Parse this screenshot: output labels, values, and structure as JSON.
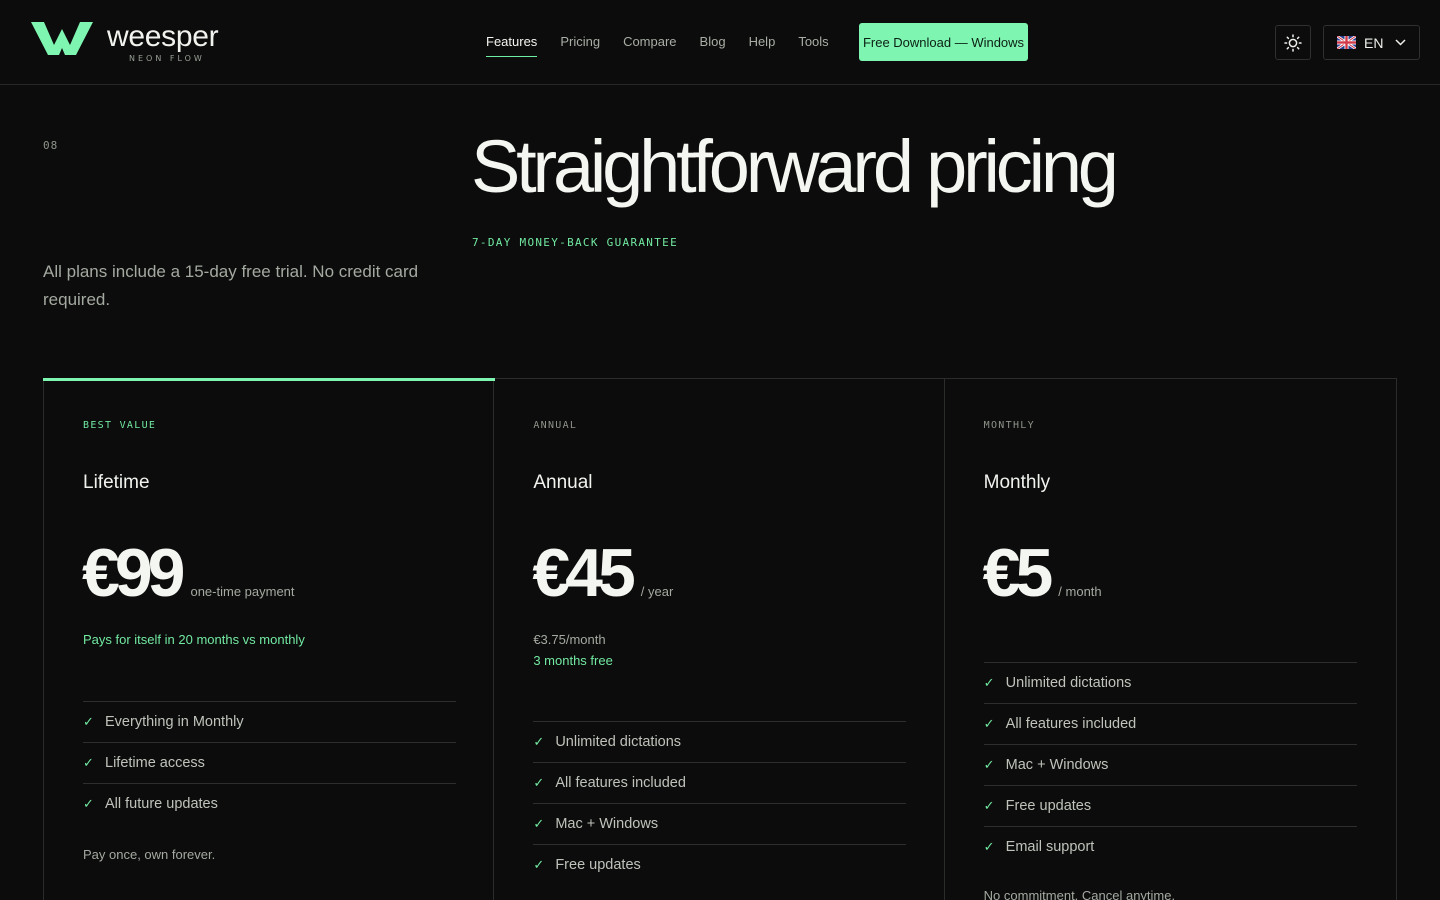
{
  "brand": {
    "name": "weesper",
    "tagline": "NEON FLOW",
    "accent": "#7ef5b0"
  },
  "nav": {
    "items": [
      {
        "label": "Features",
        "active": true
      },
      {
        "label": "Pricing",
        "active": false
      },
      {
        "label": "Compare",
        "active": false
      },
      {
        "label": "Blog",
        "active": false
      },
      {
        "label": "Help",
        "active": false
      },
      {
        "label": "Tools",
        "active": false
      }
    ],
    "cta": "Free Download — Windows"
  },
  "header_controls": {
    "theme_icon": "sun-icon",
    "language": "EN",
    "language_flag": "uk-flag-icon"
  },
  "hero": {
    "section_number": "08",
    "title": "Straightforward pricing",
    "guarantee": "7-DAY MONEY-BACK GUARANTEE",
    "subtitle": "All plans include a 15-day free trial. No credit card required."
  },
  "plans": [
    {
      "tag": "BEST VALUE",
      "name": "Lifetime",
      "price": "€99",
      "unit": "one-time payment",
      "note_green": "Pays for itself in 20 months vs monthly",
      "features": [
        "Everything in Monthly",
        "Lifetime access",
        "All future updates"
      ],
      "footnote": "Pay once, own forever."
    },
    {
      "tag": "ANNUAL",
      "name": "Annual",
      "price": "€45",
      "unit": "/ year",
      "note_grey": "€3.75/month",
      "note_green": "3 months free",
      "features": [
        "Unlimited dictations",
        "All features included",
        "Mac + Windows",
        "Free updates"
      ]
    },
    {
      "tag": "MONTHLY",
      "name": "Monthly",
      "price": "€5",
      "unit": "/ month",
      "features": [
        "Unlimited dictations",
        "All features included",
        "Mac + Windows",
        "Free updates",
        "Email support"
      ],
      "footnote": "No commitment. Cancel anytime."
    }
  ]
}
